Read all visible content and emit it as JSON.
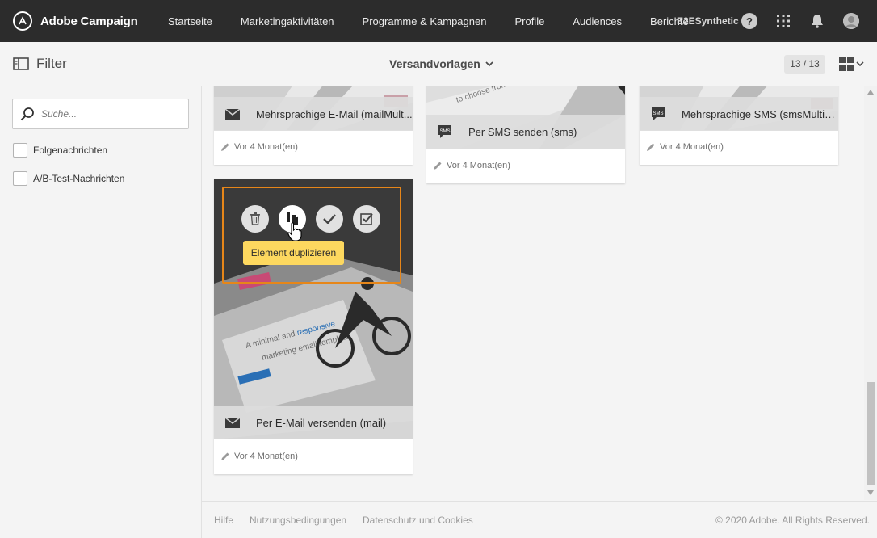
{
  "app": {
    "name": "Adobe Campaign",
    "org": "E2ESynthetic",
    "help_glyph": "?"
  },
  "nav": [
    {
      "label": "Startseite"
    },
    {
      "label": "Marketingaktivitäten"
    },
    {
      "label": "Programme & Kampagnen"
    },
    {
      "label": "Profile"
    },
    {
      "label": "Audiences"
    },
    {
      "label": "Berichte"
    }
  ],
  "subbar": {
    "filter_label": "Filter",
    "view_title": "Versandvorlagen",
    "counter": "13 / 13"
  },
  "sidebar": {
    "search_placeholder": "Suche...",
    "checkboxes": [
      {
        "label": "Folgenachrichten",
        "checked": false
      },
      {
        "label": "A/B-Test-Nachrichten",
        "checked": false
      }
    ]
  },
  "cards": [
    {
      "title": "Mehrsprachige E-Mail (mailMult...",
      "icon": "envelope-icon",
      "meta": "Vor 4 Monat(en)"
    },
    {
      "title": "Per SMS senden (sms)",
      "icon": "sms-icon",
      "meta": "Vor 4 Monat(en)"
    },
    {
      "title": "Mehrsprachige SMS (smsMultiL...",
      "icon": "sms-icon",
      "meta": "Vor 4 Monat(en)"
    },
    {
      "title": "Per E-Mail versenden (mail)",
      "icon": "envelope-icon",
      "meta": "Vor 4 Monat(en)"
    }
  ],
  "thumb_text": {
    "choose": "to choose from",
    "sms_badge": "SMS",
    "headline_a": "A minimal and",
    "headline_b": "responsive",
    "headline_c": "marketing email template"
  },
  "tooltip": "Element duplizieren",
  "footer": {
    "links": [
      "Hilfe",
      "Nutzungsbedingungen",
      "Datenschutz und Cookies"
    ],
    "copyright": "© 2020 Adobe. All Rights Reserved."
  },
  "colors": {
    "topbar": "#2c2c2c",
    "highlight": "#e68619",
    "tooltip": "#fdd85f"
  }
}
